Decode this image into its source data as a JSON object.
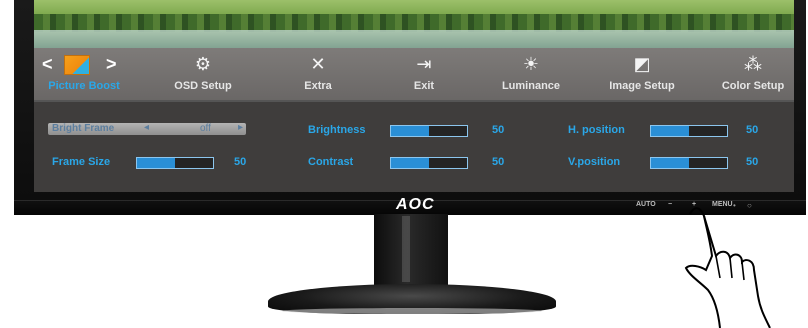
{
  "brand": "AOC",
  "menu": {
    "items": [
      {
        "label": "Picture Boost",
        "icon": "picture-boost-icon",
        "selected": true
      },
      {
        "label": "OSD Setup",
        "icon": "osd-setup-icon"
      },
      {
        "label": "Extra",
        "icon": "extra-icon"
      },
      {
        "label": "Exit",
        "icon": "exit-icon"
      },
      {
        "label": "Luminance",
        "icon": "luminance-icon"
      },
      {
        "label": "Image Setup",
        "icon": "image-setup-icon"
      },
      {
        "label": "Color Setup",
        "icon": "color-setup-icon"
      }
    ],
    "nav_left": "<",
    "nav_right": ">"
  },
  "settings": {
    "bright_frame": {
      "label": "Bright Frame",
      "value": "off"
    },
    "frame_size": {
      "label": "Frame Size",
      "value": "50",
      "level": 0.5
    },
    "brightness": {
      "label": "Brightness",
      "value": "50",
      "level": 0.5
    },
    "contrast": {
      "label": "Contrast",
      "value": "50",
      "level": 0.5
    },
    "h_position": {
      "label": "H. position",
      "value": "50",
      "level": 0.5
    },
    "v_position": {
      "label": "V.position",
      "value": "50",
      "level": 0.5
    }
  },
  "buttons": {
    "auto": "AUTO",
    "minus": "−",
    "plus": "+",
    "menu": "MENU",
    "menu_dot": "•",
    "power": "○"
  },
  "colors": {
    "accent": "#2aa7e8",
    "panel": "#3f3d3c",
    "bar_fill": "#2a8fd6"
  }
}
